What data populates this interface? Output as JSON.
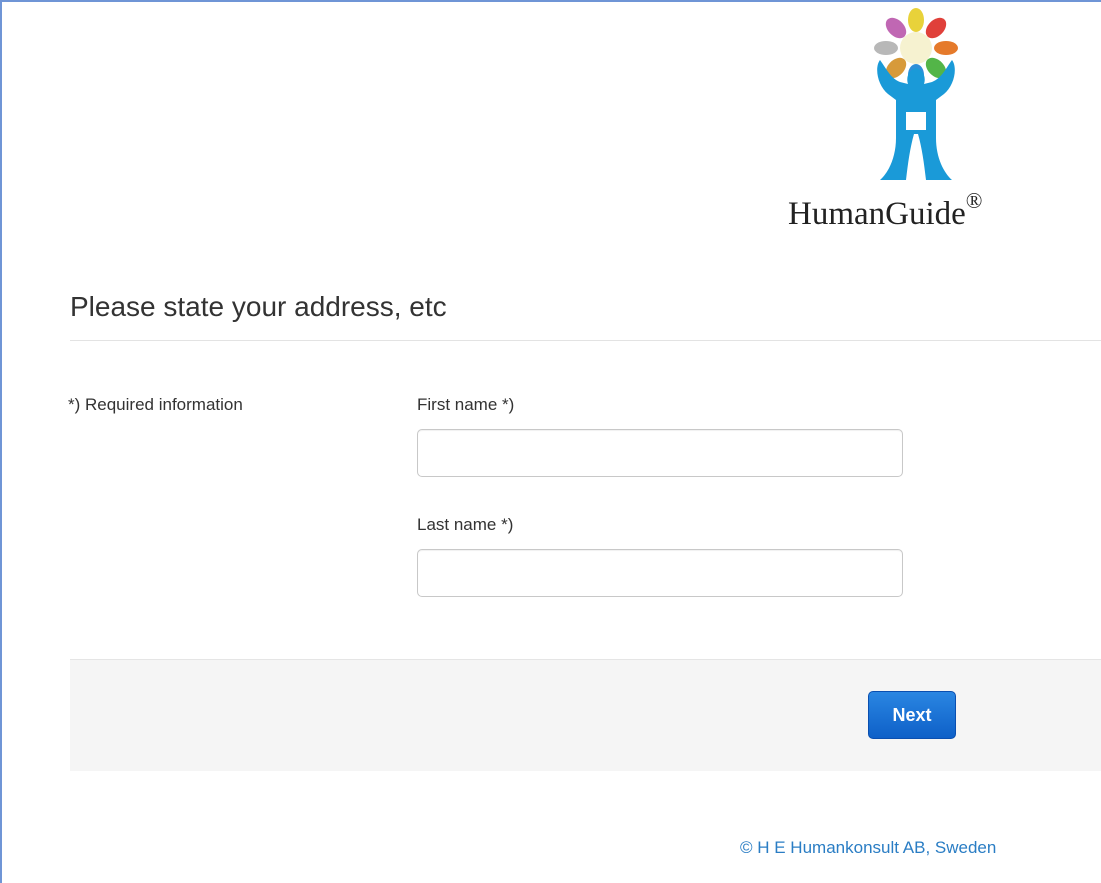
{
  "logo": {
    "brand_name": "HumanGuide",
    "registered_mark": "®",
    "icon": "humanguide-figure-logo",
    "petal_colors": [
      "#e8d23a",
      "#e0403a",
      "#e57a2b",
      "#53b548",
      "#2f8fd8",
      "#d79a3a",
      "#b8b8b8",
      "#c067b3"
    ],
    "figure_color": "#1a9ad8"
  },
  "page": {
    "heading": "Please state your address, etc",
    "required_note": "*) Required information"
  },
  "form": {
    "first_name": {
      "label": "First name *)",
      "value": "",
      "placeholder": ""
    },
    "last_name": {
      "label": "Last name *)",
      "value": "",
      "placeholder": ""
    },
    "next_label": "Next"
  },
  "footer": {
    "copyright": "© H E Humankonsult AB, Sweden"
  },
  "colors": {
    "accent": "#1a6fd6",
    "link": "#2a7dc4",
    "footer_bg": "#f5f5f5"
  }
}
